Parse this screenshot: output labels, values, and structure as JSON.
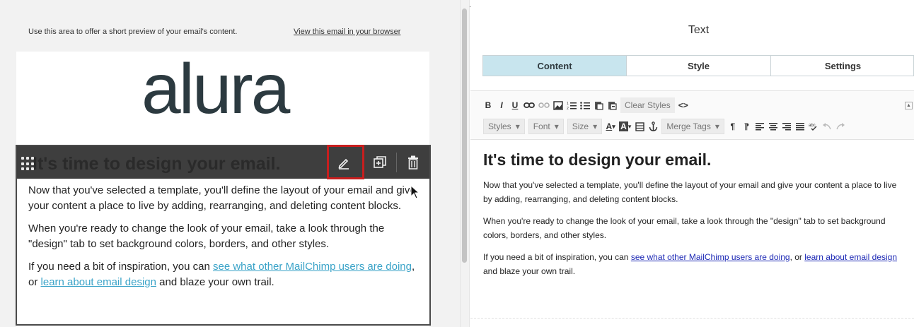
{
  "preview": {
    "preheader_text": "Use this area to offer a short preview of your email's content.",
    "view_in_browser": "View this email in your browser",
    "logo_text": "alura"
  },
  "block": {
    "heading": "It's time to design your email.",
    "toolbar_icons": [
      "drag-handle-icon",
      "edit-icon",
      "duplicate-icon",
      "trash-icon"
    ],
    "highlight_color": "#c81e1e",
    "paragraph1": "Now that you've selected a template, you'll define the layout of your email and give your content a place to live by adding, rearranging, and deleting content blocks.",
    "paragraph2": "When you're ready to change the look of your email, take a look through the \"design\" tab to set background colors, borders, and other styles.",
    "p3_before": "If you need a bit of inspiration, you can ",
    "p3_link1": "see what other MailChimp users are doing",
    "p3_mid": ", or ",
    "p3_link2": "learn about email design",
    "p3_after": " and blaze your own trail.",
    "link_color": "#3aa3c8"
  },
  "panel": {
    "title": "Text",
    "tabs": [
      {
        "label": "Content",
        "active": true
      },
      {
        "label": "Style",
        "active": false
      },
      {
        "label": "Settings",
        "active": false
      }
    ],
    "active_tab_color": "#c8e5ee"
  },
  "editor": {
    "bold": "B",
    "italic": "I",
    "underline": "U",
    "clear_styles": "Clear Styles",
    "source": "<>",
    "styles_dd": "Styles",
    "font_dd": "Font",
    "size_dd": "Size",
    "text_color": "A",
    "bg_color": "A",
    "merge_tags_dd": "Merge Tags",
    "heading": "It's time to design your email.",
    "paragraph1": "Now that you've selected a template, you'll define the layout of your email and give your content a place to live by adding, rearranging, and deleting content blocks.",
    "paragraph2": "When you're ready to change the look of your email, take a look through the \"design\" tab to set background colors, borders, and other styles.",
    "p3_before": "If you need a bit of inspiration, you can ",
    "p3_link1": "see what other MailChimp users are doing",
    "p3_mid": ", or ",
    "p3_link2": "learn about email design",
    "p3_after": " and blaze your own trail.",
    "link_color": "#1d29b5"
  }
}
